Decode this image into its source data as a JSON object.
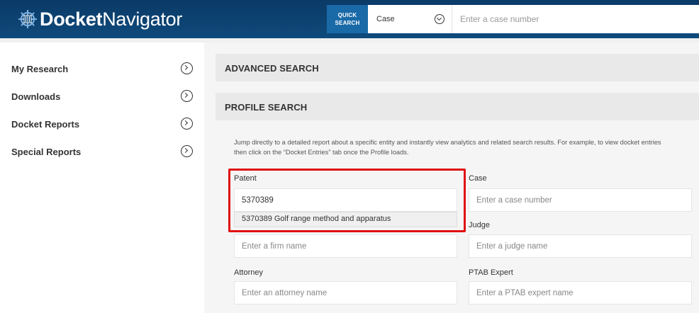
{
  "header": {
    "logo_bold": "Docket",
    "logo_light": "Navigator",
    "quick_search_label_line1": "QUICK",
    "quick_search_label_line2": "SEARCH",
    "search_type": "Case",
    "search_placeholder": "Enter a case number"
  },
  "sidebar": {
    "items": [
      {
        "label": "My Research"
      },
      {
        "label": "Downloads"
      },
      {
        "label": "Docket Reports"
      },
      {
        "label": "Special Reports"
      }
    ]
  },
  "main": {
    "advanced_search": "ADVANCED SEARCH",
    "profile_search": "PROFILE SEARCH",
    "description_line1": "Jump directly to a detailed report about a specific entity and instantly view analytics and related search results. For example, to view docket entries",
    "description_line2": "then click on the “Docket Entries” tab once the Profile loads.",
    "fields": {
      "patent": {
        "label": "Patent",
        "value": "5370389"
      },
      "patent_suggestion": "5370389 Golf range method and apparatus",
      "case": {
        "label": "Case",
        "placeholder": "Enter a case number"
      },
      "firm": {
        "placeholder": "Enter a firm name"
      },
      "judge": {
        "label": "Judge",
        "placeholder": "Enter a judge name"
      },
      "attorney": {
        "label": "Attorney",
        "placeholder": "Enter an attorney name"
      },
      "ptab": {
        "label": "PTAB Expert",
        "placeholder": "Enter a PTAB expert name"
      }
    }
  },
  "colors": {
    "header_bg": "#0e4a7c",
    "quick_search_bg": "#1a6aa8",
    "highlight": "#e01010"
  }
}
